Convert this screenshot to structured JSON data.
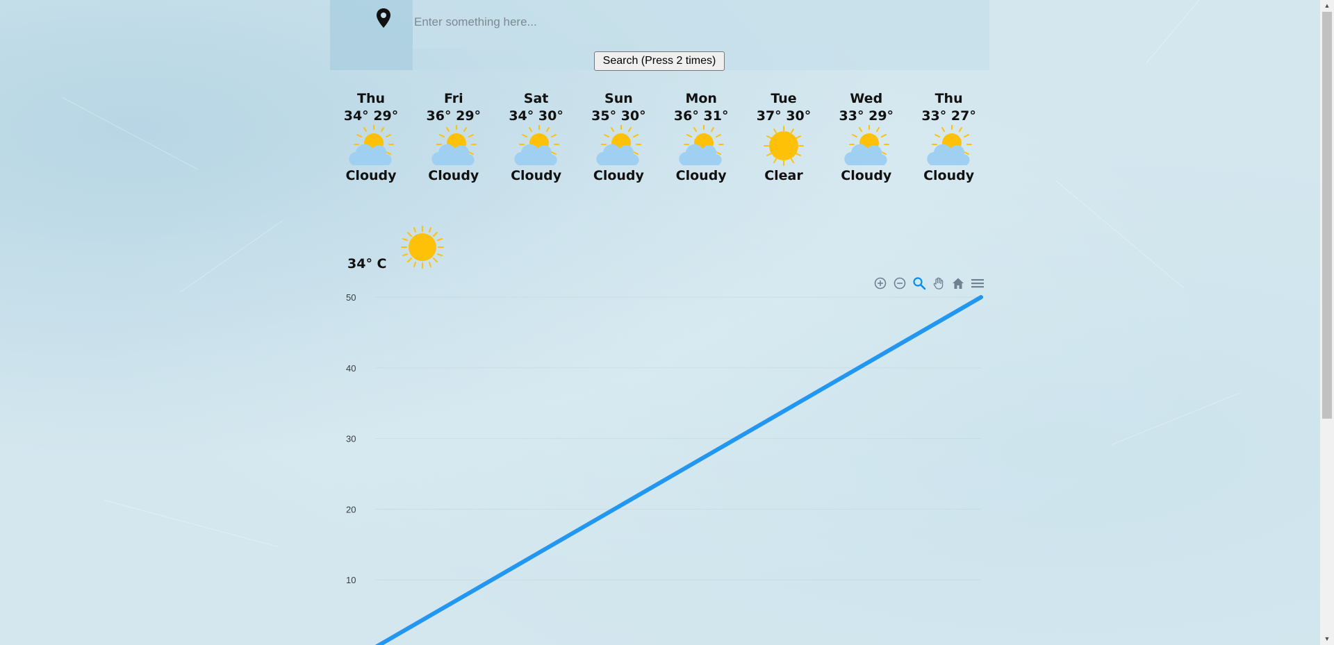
{
  "search": {
    "placeholder": "Enter something here...",
    "value": "",
    "button_label": "Search (Press 2 times)"
  },
  "forecast": [
    {
      "day": "Thu",
      "high": "34°",
      "low": "29°",
      "condition": "Cloudy",
      "icon": "partly-cloudy-icon"
    },
    {
      "day": "Fri",
      "high": "36°",
      "low": "29°",
      "condition": "Cloudy",
      "icon": "partly-cloudy-icon"
    },
    {
      "day": "Sat",
      "high": "34°",
      "low": "30°",
      "condition": "Cloudy",
      "icon": "partly-cloudy-icon"
    },
    {
      "day": "Sun",
      "high": "35°",
      "low": "30°",
      "condition": "Cloudy",
      "icon": "partly-cloudy-icon"
    },
    {
      "day": "Mon",
      "high": "36°",
      "low": "31°",
      "condition": "Cloudy",
      "icon": "partly-cloudy-icon"
    },
    {
      "day": "Tue",
      "high": "37°",
      "low": "30°",
      "condition": "Clear",
      "icon": "sun-icon"
    },
    {
      "day": "Wed",
      "high": "33°",
      "low": "29°",
      "condition": "Cloudy",
      "icon": "partly-cloudy-icon"
    },
    {
      "day": "Thu",
      "high": "33°",
      "low": "27°",
      "condition": "Cloudy",
      "icon": "partly-cloudy-icon"
    }
  ],
  "current": {
    "temperature": "34° C",
    "icon": "sun-icon"
  },
  "chart_toolbar": [
    {
      "name": "zoom-in-icon"
    },
    {
      "name": "zoom-out-icon"
    },
    {
      "name": "selection-zoom-icon"
    },
    {
      "name": "pan-icon"
    },
    {
      "name": "reset-home-icon"
    },
    {
      "name": "menu-icon"
    }
  ],
  "colors": {
    "line": "#2196f3",
    "sun": "#ffc107",
    "cloud": "#9fd0f2",
    "toolbar_active": "#008ffb",
    "toolbar": "#6e8192"
  },
  "chart_data": {
    "type": "line",
    "y_ticks": [
      "50",
      "40",
      "30",
      "20",
      "10"
    ],
    "ylim": [
      0,
      50
    ],
    "grid": true,
    "series": [
      {
        "x": [
          0,
          1
        ],
        "values": [
          0,
          50
        ]
      }
    ]
  }
}
